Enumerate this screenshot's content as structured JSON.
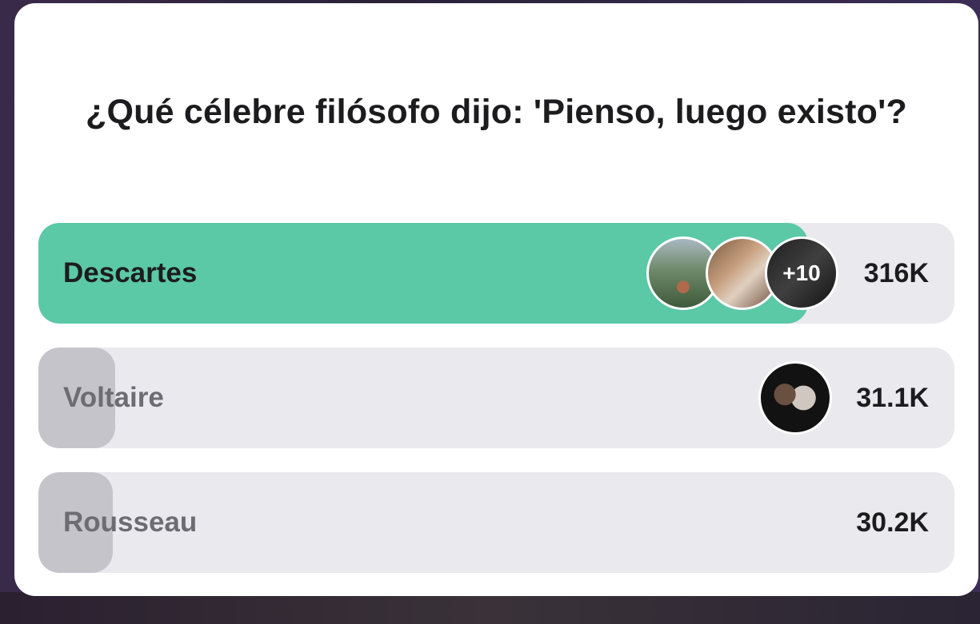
{
  "poll": {
    "question": "¿Qué célebre filósofo dijo: 'Pienso, luego existo'?",
    "options": [
      {
        "label": "Descartes",
        "count": "316K",
        "share": 0.84,
        "selected": true,
        "more_voters": "+10"
      },
      {
        "label": "Voltaire",
        "count": "31.1K",
        "share": 0.084,
        "selected": false
      },
      {
        "label": "Rousseau",
        "count": "30.2K",
        "share": 0.081,
        "selected": false
      }
    ]
  },
  "colors": {
    "winner_fill": "#5bc8a6",
    "loser_fill": "#c4c4ca",
    "track": "#e9e9ee"
  }
}
